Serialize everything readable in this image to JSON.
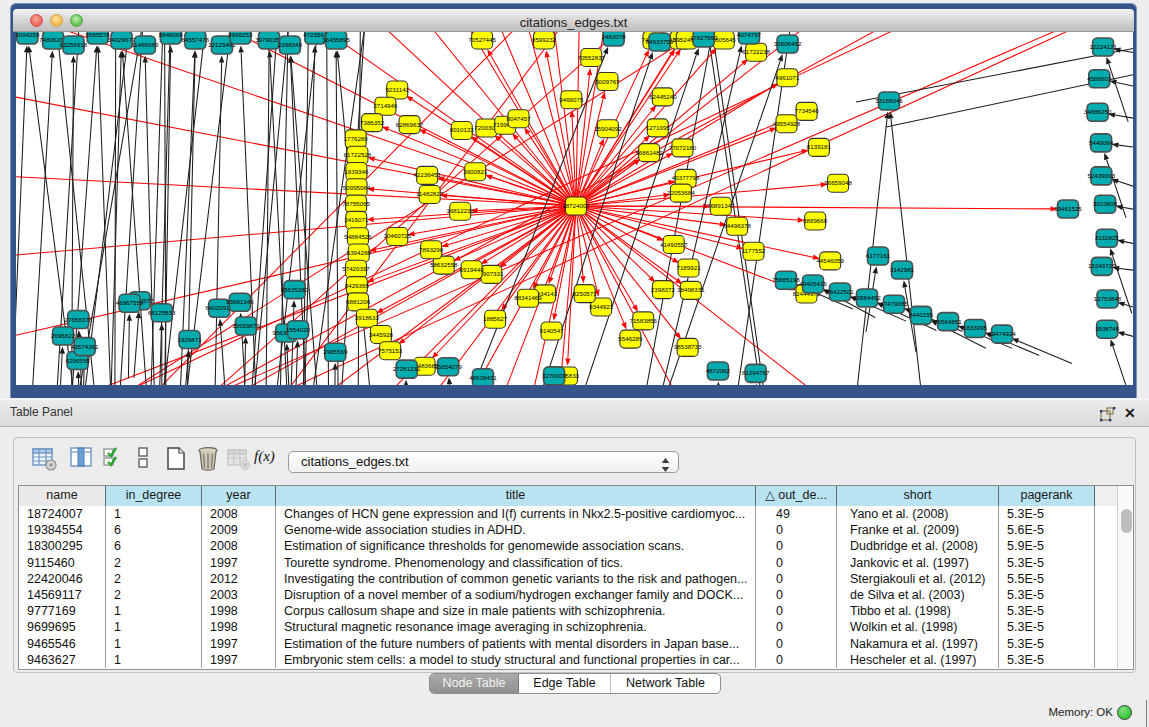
{
  "window": {
    "title": "citations_edges.txt"
  },
  "graph": {
    "hub_label": "18724007",
    "paper_node_color": "#ffff00",
    "neighbor_node_color": "#00acad",
    "citation_edge_color": "#ff0000",
    "other_edge_color": "#1c1c1c",
    "canvas_background": "#ffffff"
  },
  "panel": {
    "title": "Table Panel"
  },
  "toolbar": {
    "combo_value": "citations_edges.txt",
    "fx_label": "f(x)"
  },
  "table": {
    "columns": [
      "name",
      "in_degree",
      "year",
      "title",
      "out_de...",
      "short",
      "pagerank"
    ],
    "sort": {
      "column_index": 4,
      "indicator": "asc"
    },
    "rows": [
      [
        "18724007",
        "1",
        "2008",
        "Changes of HCN gene expression and I(f) currents in Nkx2.5-positive cardiomyoc...",
        "49",
        "Yano et al. (2008)",
        "5.3E-5"
      ],
      [
        "19384554",
        "6",
        "2009",
        "Genome-wide association studies in ADHD.",
        "0",
        "Franke et al. (2009)",
        "5.6E-5"
      ],
      [
        "18300295",
        "6",
        "2008",
        "Estimation of significance thresholds for genomewide association scans.",
        "0",
        "Dudbridge et al. (2008)",
        "5.9E-5"
      ],
      [
        "9115460",
        "2",
        "1997",
        "Tourette syndrome. Phenomenology and classification of tics.",
        "0",
        "Jankovic et al. (1997)",
        "5.3E-5"
      ],
      [
        "22420046",
        "2",
        "2012",
        "Investigating the contribution of common genetic variants to the risk and pathogen...",
        "0",
        "Stergiakouli et al. (2012)",
        "5.5E-5"
      ],
      [
        "14569117",
        "2",
        "2003",
        "Disruption of a novel member of a sodium/hydrogen exchanger family and DOCK...",
        "0",
        "de Silva et al. (2003)",
        "5.3E-5"
      ],
      [
        "9777169",
        "1",
        "1998",
        "Corpus callosum shape and size in male patients with schizophrenia.",
        "0",
        "Tibbo et al. (1998)",
        "5.3E-5"
      ],
      [
        "9699695",
        "1",
        "1998",
        "Structural magnetic resonance image averaging in schizophrenia.",
        "0",
        "Wolkin et al. (1998)",
        "5.3E-5"
      ],
      [
        "9465546",
        "1",
        "1997",
        "Estimation of the future numbers of patients with mental disorders in Japan base...",
        "0",
        "Nakamura et al. (1997)",
        "5.3E-5"
      ],
      [
        "9463627",
        "1",
        "1997",
        "Embryonic stem cells: a model to study structural and functional properties in car...",
        "0",
        "Hescheler et al. (1997)",
        "5.3E-5"
      ]
    ]
  },
  "tabs": [
    {
      "label": "Node Table",
      "selected": true
    },
    {
      "label": "Edge Table",
      "selected": false
    },
    {
      "label": "Network Table",
      "selected": false
    }
  ],
  "status": {
    "memory_label": "Memory: OK"
  }
}
